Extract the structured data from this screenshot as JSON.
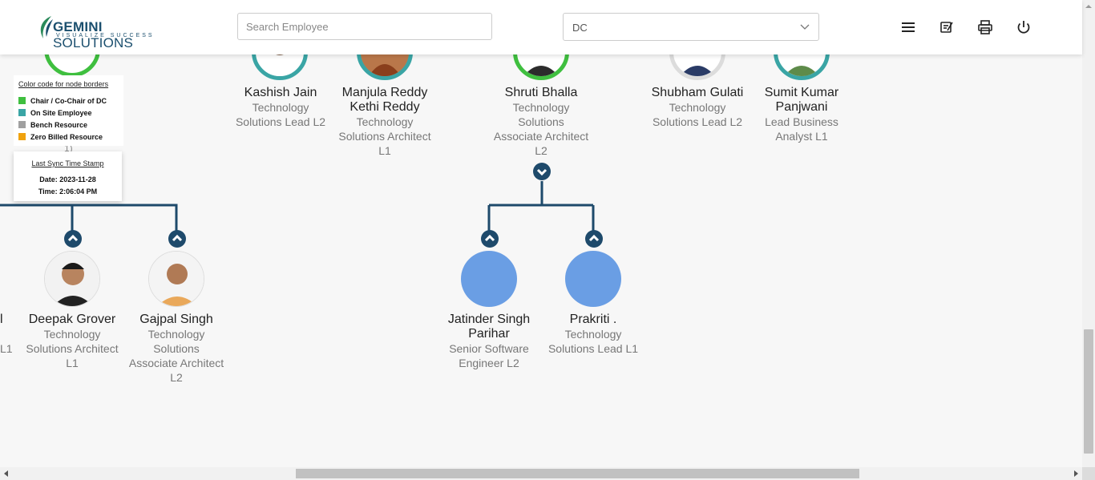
{
  "brand": {
    "name_bold": "GEMINI",
    "name_rest": " SOLUTIONS",
    "tagline": "VISUALIZE SUCCESS"
  },
  "search": {
    "placeholder": "Search Employee",
    "value": ""
  },
  "dc_select": {
    "value": "DC"
  },
  "header_icons": [
    "menu-icon",
    "edit-note-icon",
    "print-icon",
    "power-icon"
  ],
  "colors": {
    "chair": "#3fbf3f",
    "on_site": "#3aa5a5",
    "bench": "#a0a0a0",
    "zero_billed": "#f0a20e",
    "connector": "#1e4a6b",
    "placeholder_avatar": "#6a9ee4"
  },
  "legend": {
    "title": "Color code for node borders",
    "items": [
      "Chair / Co-Chair of DC",
      "On Site Employee",
      "Bench Resource",
      "Zero Billed Resource"
    ]
  },
  "sync": {
    "title": "Last Sync Time Stamp",
    "date": "Date: 2023-11-28",
    "time": "Time: 2:06:04 PM"
  },
  "top_nodes": [
    {
      "name": "Kashish Jain",
      "role": "Technology Solutions Lead L2"
    },
    {
      "name": "Manjula Reddy Kethi Reddy",
      "role": "Technology Solutions Architect L1"
    },
    {
      "name": "Shruti Bhalla",
      "role": "Technology Solutions Associate Architect L2"
    },
    {
      "name": "Shubham Gulati",
      "role": "Technology Solutions Lead L2"
    },
    {
      "name": "Sumit Kumar Panjwani",
      "role": "Lead Business Analyst L1"
    }
  ],
  "left_cut": {
    "top_fragment": "l",
    "role_fragment": "L1",
    "behind_legend": "1)"
  },
  "bottom_nodes": [
    {
      "name": "Deepak Grover",
      "role": "Technology Solutions Architect L1"
    },
    {
      "name": "Gajpal Singh",
      "role": "Technology Solutions Associate Architect L2"
    },
    {
      "name": "Jatinder Singh Parihar",
      "role": "Senior Software Engineer L2"
    },
    {
      "name": "Prakriti .",
      "role": "Technology Solutions Lead L1"
    }
  ]
}
